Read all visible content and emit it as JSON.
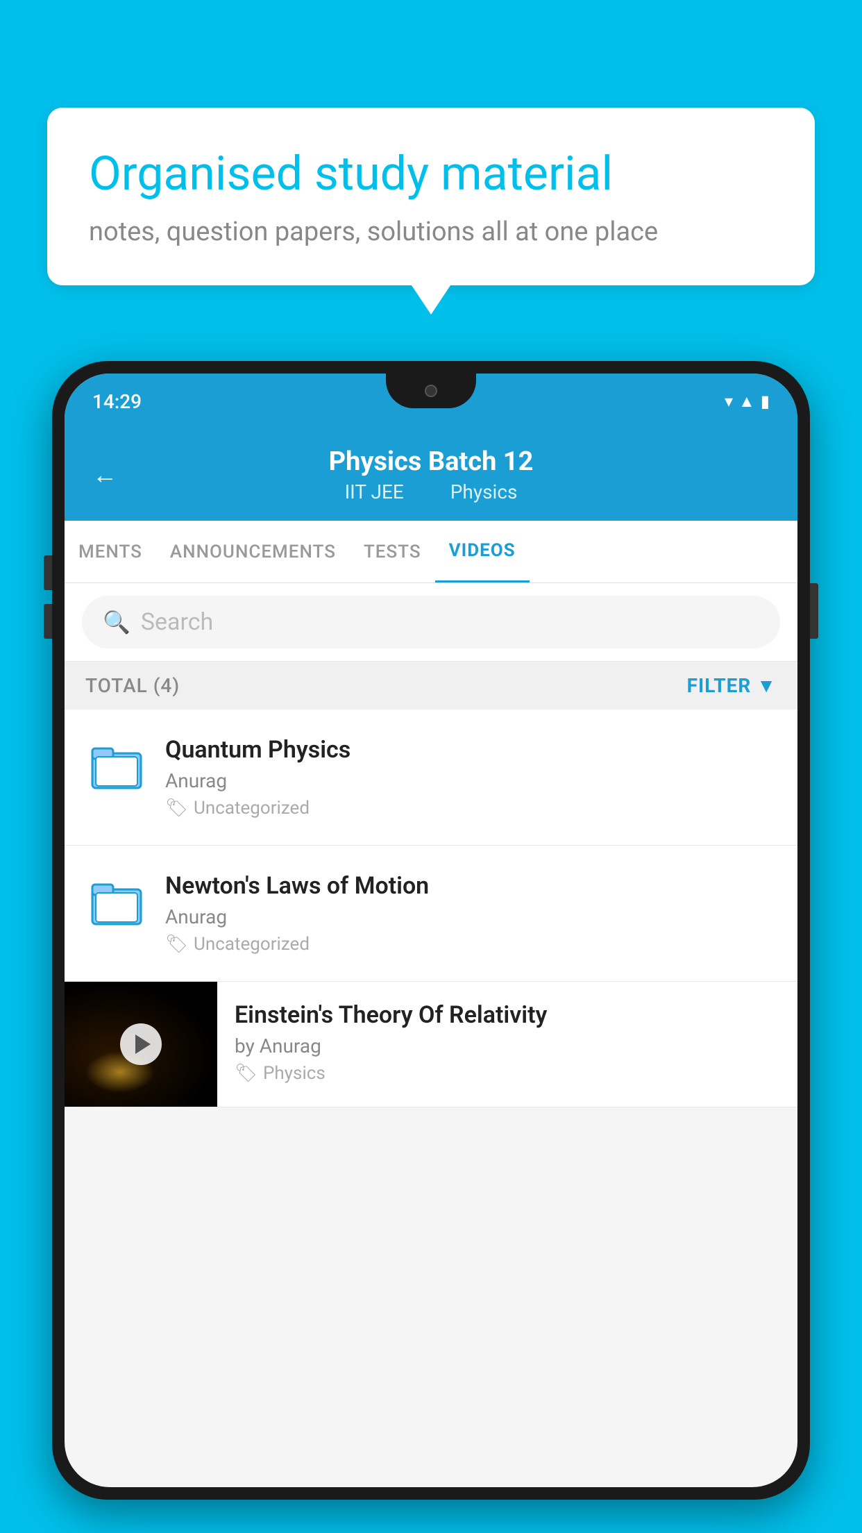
{
  "background": {
    "color": "#00BFEA"
  },
  "speech_bubble": {
    "title": "Organised study material",
    "subtitle": "notes, question papers, solutions all at one place"
  },
  "phone": {
    "status_bar": {
      "time": "14:29"
    },
    "header": {
      "back_label": "←",
      "title": "Physics Batch 12",
      "subtitle_tag1": "IIT JEE",
      "subtitle_tag2": "Physics"
    },
    "tabs": [
      {
        "label": "MENTS",
        "active": false
      },
      {
        "label": "ANNOUNCEMENTS",
        "active": false
      },
      {
        "label": "TESTS",
        "active": false
      },
      {
        "label": "VIDEOS",
        "active": true
      }
    ],
    "search": {
      "placeholder": "Search"
    },
    "filter_bar": {
      "total_label": "TOTAL (4)",
      "filter_label": "FILTER"
    },
    "videos": [
      {
        "id": 1,
        "title": "Quantum Physics",
        "author": "Anurag",
        "tag": "Uncategorized",
        "type": "folder"
      },
      {
        "id": 2,
        "title": "Newton's Laws of Motion",
        "author": "Anurag",
        "tag": "Uncategorized",
        "type": "folder"
      },
      {
        "id": 3,
        "title": "Einstein's Theory Of Relativity",
        "author": "by Anurag",
        "tag": "Physics",
        "type": "video"
      }
    ]
  }
}
